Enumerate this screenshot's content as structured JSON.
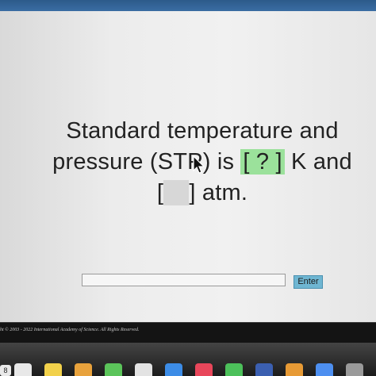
{
  "question": {
    "line1": "Standard temperature and",
    "line2_prefix": "pressure (STP) is ",
    "blank1": "[ ? ]",
    "line2_suffix": " K and",
    "blank2_open": "[",
    "blank2_close": "]",
    "line3_suffix": " atm."
  },
  "answer": {
    "input_value": "",
    "enter_label": "Enter"
  },
  "footer": {
    "copyright": "ht © 2003 - 2022 International Academy of Science.  All Rights Reserved."
  },
  "dock": {
    "badge": "8",
    "apps": [
      {
        "name": "finder-icon",
        "color": "#e8e8e8"
      },
      {
        "name": "notes-icon",
        "color": "#f2d14b"
      },
      {
        "name": "photos-icon",
        "color": "#e8a23c"
      },
      {
        "name": "messages-icon",
        "color": "#5bc45a"
      },
      {
        "name": "chrome-icon",
        "color": "#e3e3e3"
      },
      {
        "name": "app-store-icon",
        "color": "#3c8ce6"
      },
      {
        "name": "music-icon",
        "color": "#e8465a"
      },
      {
        "name": "facetime-icon",
        "color": "#4cc05a"
      },
      {
        "name": "word-icon",
        "color": "#3b5fb0"
      },
      {
        "name": "books-icon",
        "color": "#e79a35"
      },
      {
        "name": "zoom-icon",
        "color": "#4d8ff0"
      },
      {
        "name": "settings-icon",
        "color": "#9a9a9a"
      }
    ]
  }
}
